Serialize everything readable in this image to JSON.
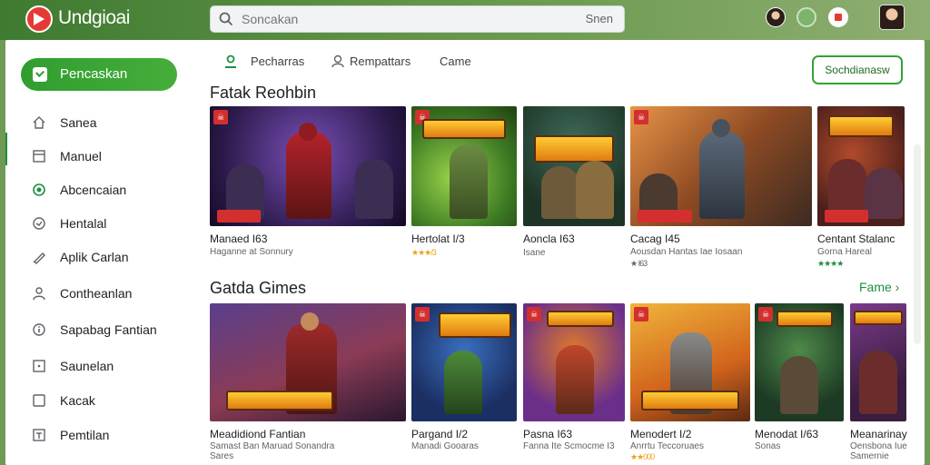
{
  "header": {
    "brand": "Undgioai",
    "search_placeholder": "Soncakan",
    "search_scope": "Snen"
  },
  "sidebar": {
    "active": "Pencaskan",
    "items": [
      {
        "label": "Sanea",
        "icon": "home-icon"
      },
      {
        "label": "Manuel",
        "icon": "monitor-icon"
      },
      {
        "label": "Abcencaian",
        "icon": "target-icon"
      },
      {
        "label": "Hentalal",
        "icon": "gauge-icon"
      },
      {
        "label": "Aplik Carlan",
        "icon": "pen-icon"
      },
      {
        "label": "Contheanlan",
        "icon": "person-icon"
      },
      {
        "label": "Sapabag Fantian",
        "icon": "info-icon"
      },
      {
        "label": "Saunelan",
        "icon": "square-dot-icon"
      },
      {
        "label": "Kacak",
        "icon": "square-icon"
      },
      {
        "label": "Pemtilan",
        "icon": "text-box-icon"
      }
    ]
  },
  "chips": [
    {
      "label": "Pecharras",
      "icon": "user-icon"
    },
    {
      "label": "Rempattars",
      "icon": "user-outline-icon"
    },
    {
      "label": "Came",
      "icon": ""
    }
  ],
  "subscribe_label": "Sochdianasw",
  "sections": [
    {
      "title": "Fatak Reohbin",
      "cards": [
        {
          "name": "Manaed I63",
          "meta": "Haganne at Sonnury",
          "stars": ""
        },
        {
          "name": "Hertolat I/3",
          "meta": "",
          "stars": "★★★/3"
        },
        {
          "name": "Aoncla I63",
          "meta": "Isane",
          "stars": ""
        },
        {
          "name": "Cacag I45",
          "meta": "Aousdan Hantas Iae Iosaan",
          "stars": "★ I63"
        },
        {
          "name": "Centant Stalanc",
          "meta": "Gorna Hareal",
          "stars": "★★★★"
        }
      ]
    },
    {
      "title": "Gatda Gimes",
      "see_more": "Fame ›",
      "cards": [
        {
          "name": "Meadidiond Fantian",
          "meta": "Samast Ban Maruad Sonandra",
          "meta2": "Sares",
          "stars": ""
        },
        {
          "name": "Pargand I/2",
          "meta": "Manadi Gooaras",
          "meta2": "",
          "stars": ""
        },
        {
          "name": "Pasna I63",
          "meta": "Fanna Ite Scmocme I3",
          "meta2": "",
          "stars": ""
        },
        {
          "name": "Menodert I/2",
          "meta": "Anrrtu Teccoruaes",
          "meta2": "",
          "stars": "★★000"
        },
        {
          "name": "Menodat I/63",
          "meta": "Sonas",
          "meta2": "",
          "stars": ""
        },
        {
          "name": "Meanarinay",
          "meta": "Oensbona Iue",
          "meta2": "Samernie",
          "stars": ""
        }
      ]
    }
  ],
  "colors": {
    "accent": "#2f9e2f",
    "badge": "#d32f2f"
  }
}
